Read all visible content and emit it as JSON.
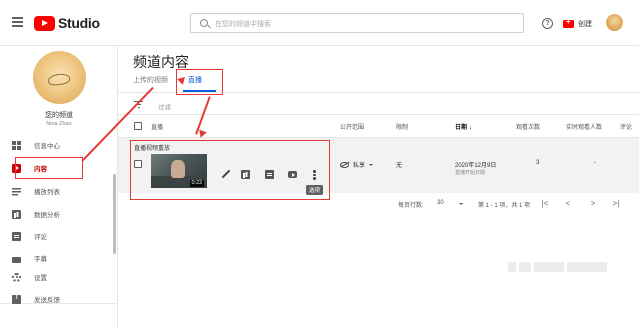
{
  "header": {
    "logo_text": "Studio",
    "search_placeholder": "在您的频道中搜索",
    "help_icon": "?",
    "create_label": "创建"
  },
  "sidebar": {
    "channel_label": "您的频道",
    "channel_name": "Nina Zhao",
    "items": [
      {
        "label": "信息中心",
        "icon": "dashboard-icon"
      },
      {
        "label": "内容",
        "icon": "content-icon",
        "active": true
      },
      {
        "label": "播放列表",
        "icon": "playlist-icon"
      },
      {
        "label": "数据分析",
        "icon": "analytics-icon"
      },
      {
        "label": "评论",
        "icon": "comments-icon"
      },
      {
        "label": "字幕",
        "icon": "subtitles-icon"
      },
      {
        "label": "设置",
        "icon": "gear-icon"
      },
      {
        "label": "发送反馈",
        "icon": "feedback-icon"
      }
    ]
  },
  "main": {
    "title": "频道内容",
    "tabs": [
      {
        "label": "上传的视频"
      },
      {
        "label": "直播",
        "selected": true
      }
    ],
    "filter_label": "过滤",
    "columns": [
      "直播",
      "公开范围",
      "限制",
      "日期",
      "观看次数",
      "实时观看人数",
      "评论"
    ],
    "section_label": "直播视频重放",
    "row": {
      "duration": "0:22",
      "visibility": "私享",
      "restriction": "无",
      "date": "2020年12月9日",
      "date_sub": "直播开始日期",
      "views": "3",
      "peak_viewers": "-",
      "tooltip": "选项"
    },
    "pagination": {
      "rows_label": "每页行数:",
      "rows_value": "30",
      "range": "第 1 - 1 项，共 1 项",
      "first": "|<",
      "prev": "<",
      "next": ">",
      "last": ">|"
    }
  },
  "colors": {
    "accent_red": "#ff0000",
    "annotation_red": "#e53935",
    "link_blue": "#065fd4"
  }
}
